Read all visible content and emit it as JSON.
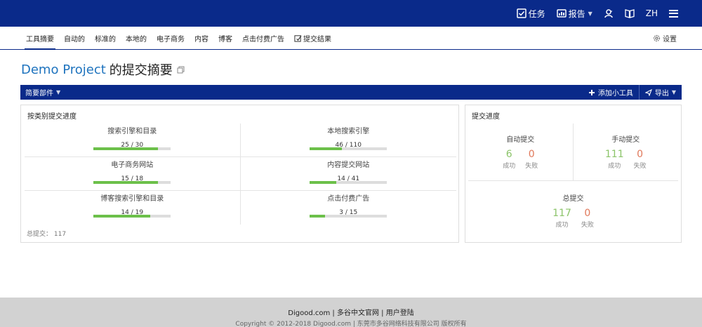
{
  "header": {
    "tasks_label": "任务",
    "reports_label": "报告",
    "lang_label": "ZH"
  },
  "nav": {
    "tabs": [
      {
        "label": "工具摘要"
      },
      {
        "label": "自动的"
      },
      {
        "label": "标准的"
      },
      {
        "label": "本地的"
      },
      {
        "label": "电子商务"
      },
      {
        "label": "内容"
      },
      {
        "label": "博客"
      },
      {
        "label": "点击付费广告"
      },
      {
        "label": "提交结果"
      }
    ],
    "settings_label": "设置"
  },
  "page": {
    "project_name": "Demo Project",
    "title_suffix": "的提交摘要"
  },
  "widget_bar": {
    "summary_label": "简要部件",
    "add_widget_label": "添加小工具",
    "export_label": "导出"
  },
  "category_panel": {
    "title": "按类别提交进度",
    "cells": [
      {
        "label": "搜索引擎和目录",
        "count": "25 / 30",
        "progress": 0.833
      },
      {
        "label": "本地搜索引擎",
        "count": "46 / 110",
        "progress": 0.418
      },
      {
        "label": "电子商务网站",
        "count": "15 / 18",
        "progress": 0.833
      },
      {
        "label": "内容提交网站",
        "count": "14 / 41",
        "progress": 0.341
      },
      {
        "label": "博客搜索引擎和目录",
        "count": "14 / 19",
        "progress": 0.737
      },
      {
        "label": "点击付费广告",
        "count": "3 / 15",
        "progress": 0.2
      }
    ],
    "total_label": "总提交： 117"
  },
  "progress_panel": {
    "title": "提交进度",
    "auto": {
      "name": "自动提交",
      "success": "6",
      "success_label": "成功",
      "fail": "0",
      "fail_label": "失败"
    },
    "manual": {
      "name": "手动提交",
      "success": "111",
      "success_label": "成功",
      "fail": "0",
      "fail_label": "失败"
    },
    "total": {
      "name": "总提交",
      "success": "117",
      "success_label": "成功",
      "fail": "0",
      "fail_label": "失败"
    }
  },
  "footer": {
    "links": "Digood.com | 多谷中文官网 | 用户登陆",
    "copyright": "Copyright © 2012-2018 Digood.com | 东莞市多谷网络科技有限公司 版权所有"
  },
  "colors": {
    "brand": "#0a2a8a",
    "progress": "#6cc04a",
    "success": "#8cc46a",
    "fail": "#e0785a",
    "project_link": "#1e73be"
  }
}
